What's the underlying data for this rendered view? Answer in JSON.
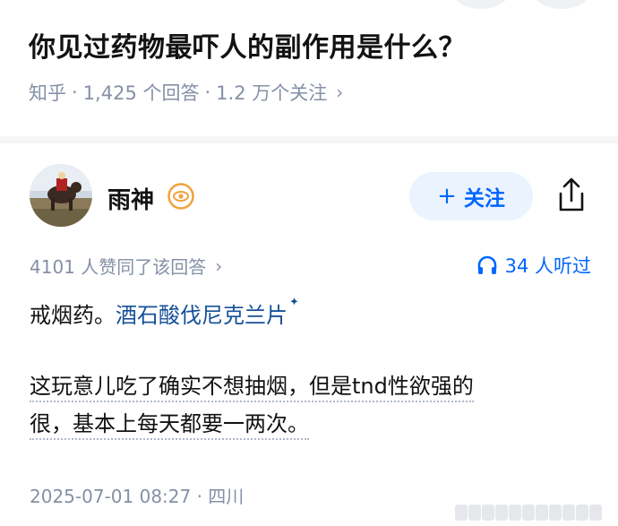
{
  "question": {
    "title": "你见过药物最吓人的副作用是什么？",
    "meta_source": "知乎",
    "meta_sep1": "·",
    "meta_answers": "1,425 个回答",
    "meta_sep2": "·",
    "meta_followers": "1.2 万个关注",
    "meta_chevron": "›"
  },
  "author": {
    "name": "雨神",
    "badge_icon": "eye-badge-icon",
    "follow_plus": "+",
    "follow_label": "关注",
    "share_icon": "share-icon"
  },
  "answer": {
    "upvote_text": "4101 人赞同了该回答",
    "upvote_chevron": "›",
    "listen_count": "34 人听过",
    "p1_text": "戒烟药。",
    "p1_link": "酒石酸伐尼克兰片",
    "p1_spark": "✦",
    "p2_line1": "这玩意儿吃了确实不想抽烟，但是tnd性欲强的",
    "p2_line2": "很，基本上每天都要一两次。",
    "date": "2025-07-01 08:27 · 四川"
  },
  "colors": {
    "accent": "#0066ff",
    "follow_bg": "#ebf3ff",
    "muted": "#8590a6",
    "link": "#175199",
    "badge": "#f0a23a"
  }
}
